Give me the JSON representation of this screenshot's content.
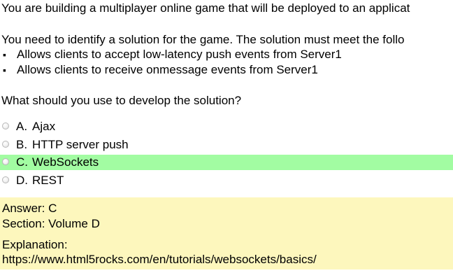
{
  "question": {
    "intro": "You are building a multiplayer online game that will be deployed to an applicat",
    "requirement_intro": "You need to identify a solution for the game. The solution must meet the follo",
    "requirements": [
      "Allows clients to accept low-latency push events from Server1",
      "Allows clients to receive onmessage events from Server1"
    ],
    "prompt": "What should you use to develop the solution?"
  },
  "options": [
    {
      "letter": "A.",
      "text": "Ajax",
      "correct": false
    },
    {
      "letter": "B.",
      "text": "HTTP server push",
      "correct": false
    },
    {
      "letter": "C.",
      "text": "WebSockets",
      "correct": true
    },
    {
      "letter": "D.",
      "text": "REST",
      "correct": false
    }
  ],
  "answer": {
    "answer_line": "Answer: C",
    "section_line": "Section: Volume D",
    "explanation_label": "Explanation:",
    "explanation_url": "https://www.html5rocks.com/en/tutorials/websockets/basics/"
  },
  "colors": {
    "correct_highlight": "#a2fca2",
    "answer_background": "#fdf7bd"
  }
}
